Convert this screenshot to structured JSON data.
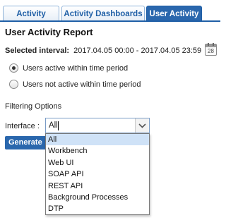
{
  "tabs": [
    {
      "label": "Activity",
      "active": false
    },
    {
      "label": "Activity Dashboards",
      "active": false
    },
    {
      "label": "User Activity",
      "active": true
    }
  ],
  "page_title": "User Activity Report",
  "interval": {
    "label": "Selected interval:",
    "value": "2017.04.05 00:00 - 2017.04.05 23:59",
    "calendar_icon_number": "28"
  },
  "radios": [
    {
      "label": "Users active within time period",
      "checked": true
    },
    {
      "label": "Users not active within time period",
      "checked": false
    }
  ],
  "filtering": {
    "heading": "Filtering Options",
    "interface_label": "Interface :",
    "selected_value": "All",
    "options": [
      "All",
      "Workbench",
      "Web UI",
      "SOAP API",
      "REST API",
      "Background Processes",
      "DTP"
    ]
  },
  "generate_label": "Generate",
  "colors": {
    "accent": "#2a67ad",
    "selected_option": "#cfe2f7"
  }
}
